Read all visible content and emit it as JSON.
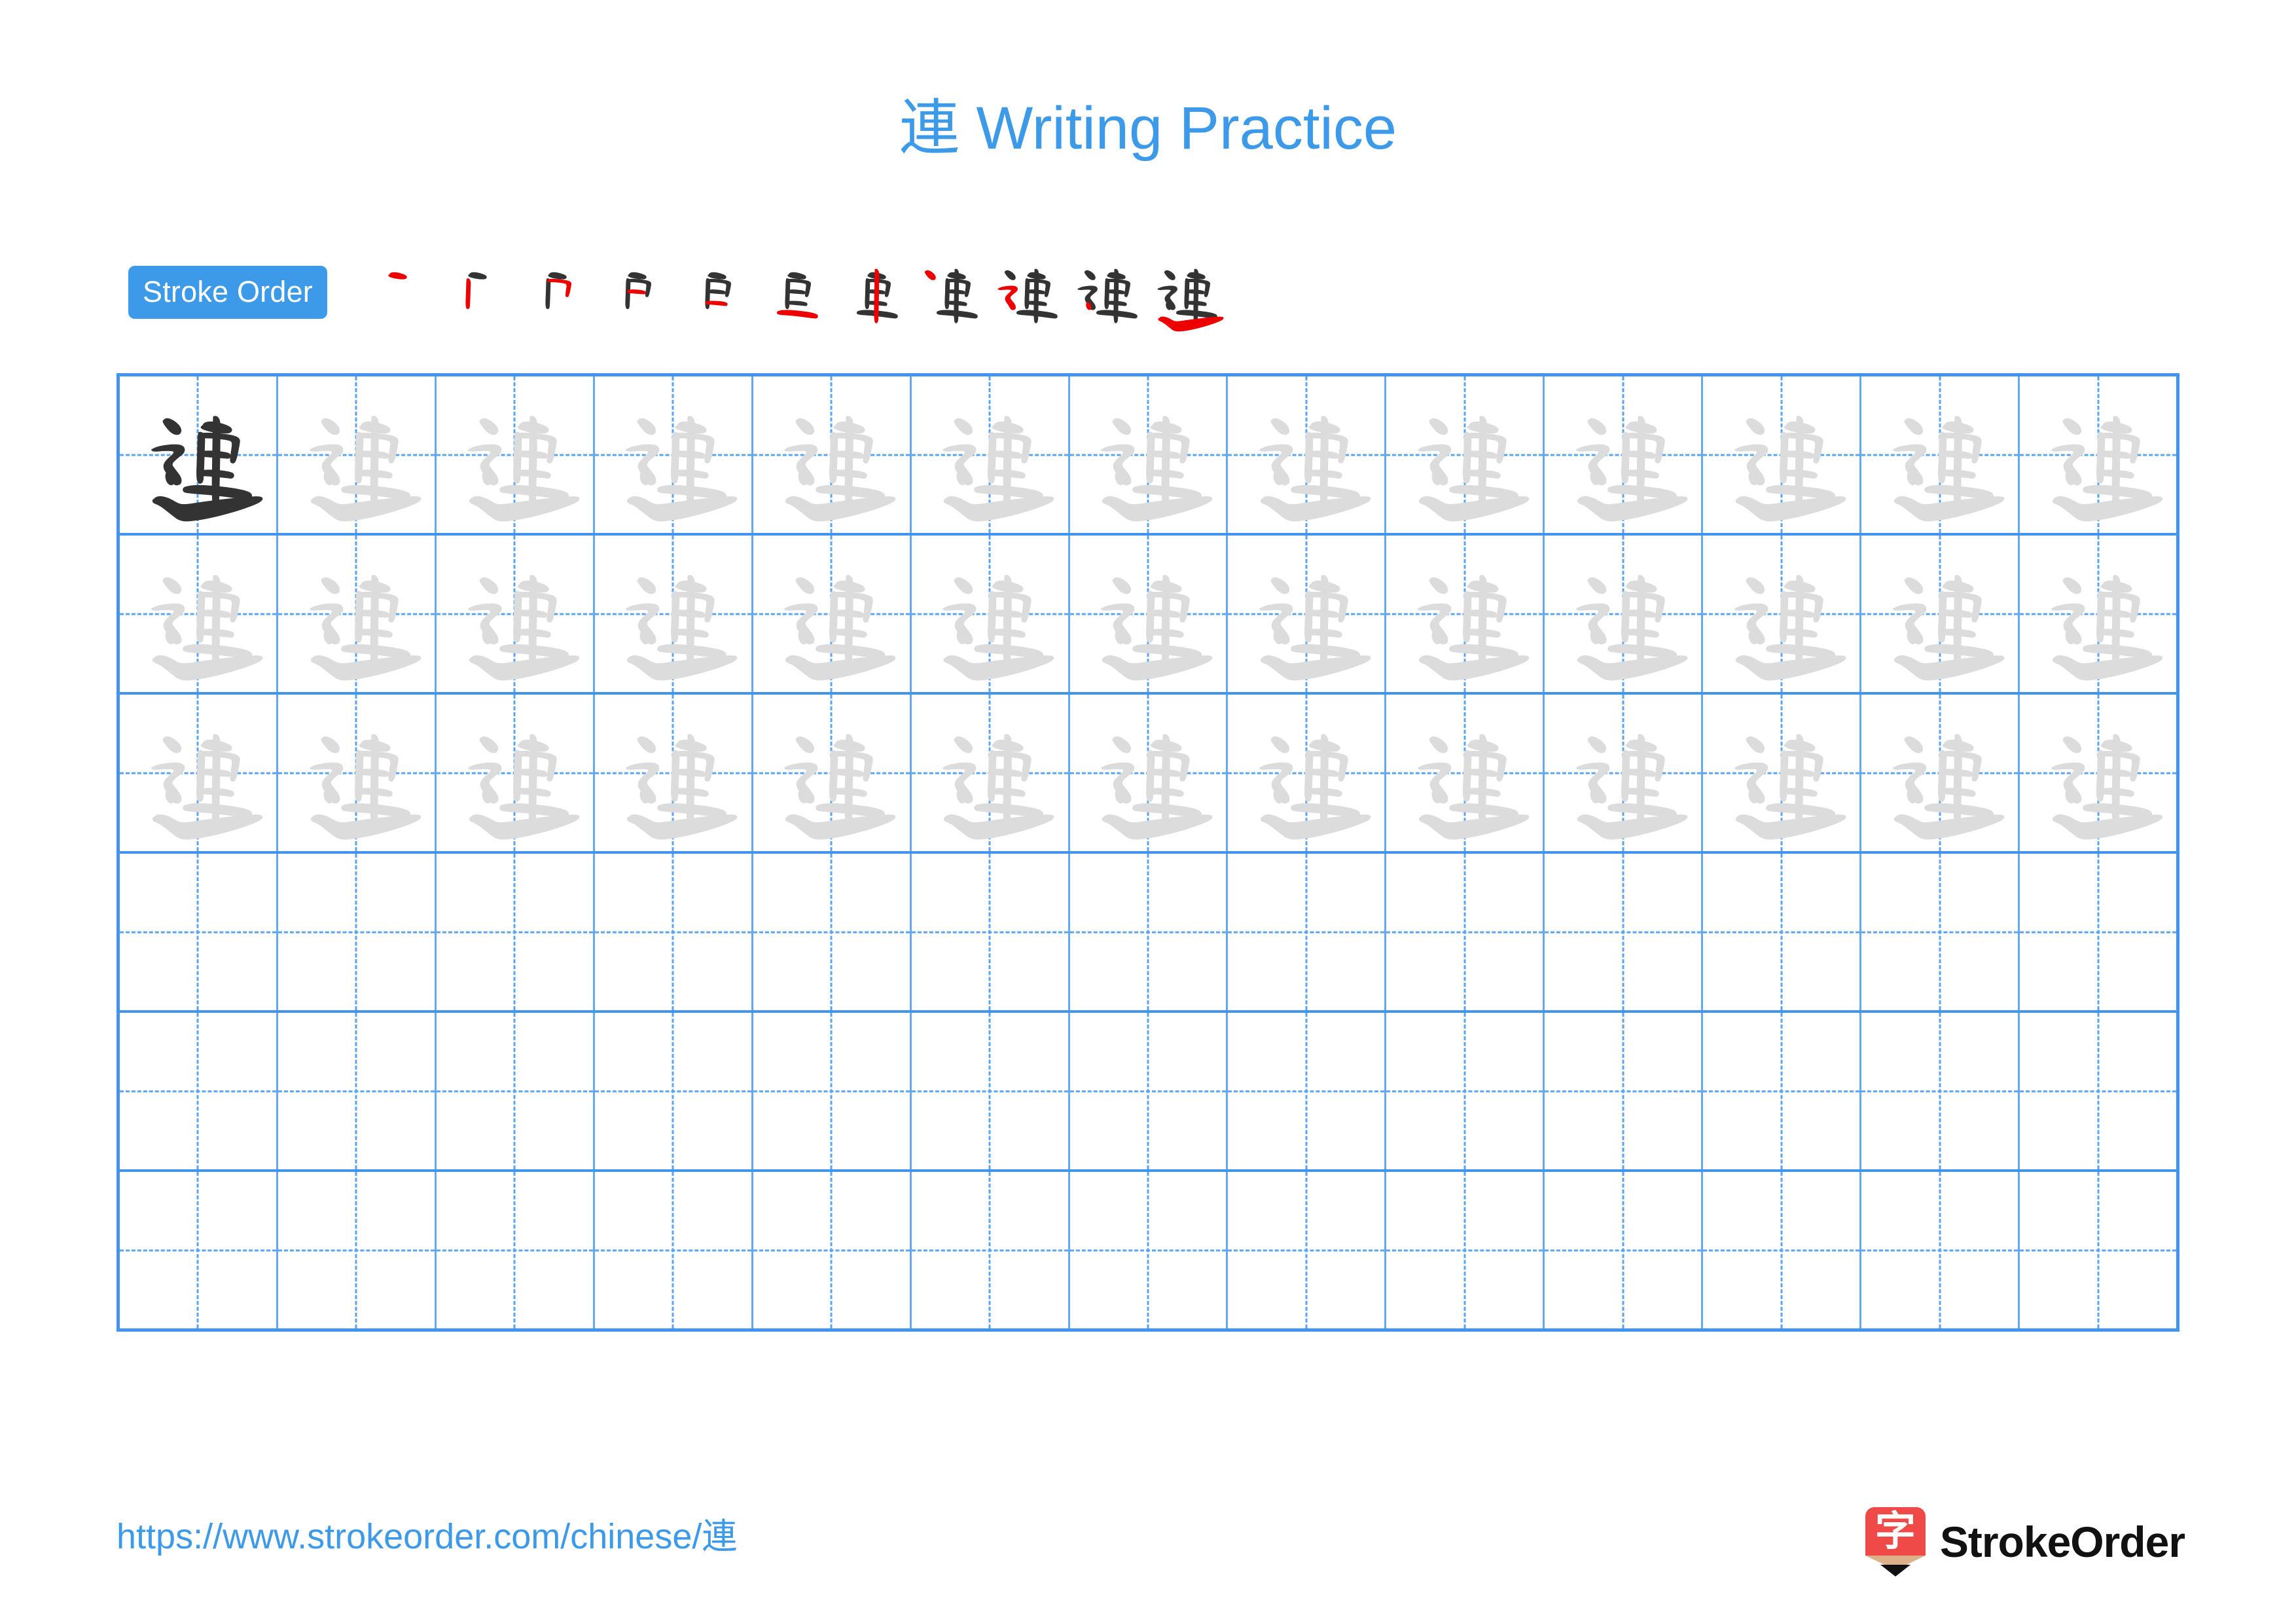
{
  "document": {
    "character": "連",
    "title": "連 Writing Practice",
    "title_character": "連",
    "title_text": " Writing Practice",
    "background_color": "#ffffff"
  },
  "colors": {
    "accent_blue": "#3d9ae8",
    "grid_border_blue": "#4294ee",
    "grid_inner_blue": "#64a9f0",
    "guide_dash_blue": "#5ba4ef",
    "stroke_new_red": "#ee0000",
    "stroke_done_black": "#333333",
    "trace_gray": "#dcdcdc",
    "logo_red": "#ef4a48",
    "logo_wood": "#dcb189"
  },
  "stroke_order": {
    "badge_label": "Stroke Order",
    "total_strokes": 11,
    "steps": [
      {
        "index": 1,
        "new_stroke": 1,
        "strokes_shown": 1
      },
      {
        "index": 2,
        "new_stroke": 2,
        "strokes_shown": 2
      },
      {
        "index": 3,
        "new_stroke": 3,
        "strokes_shown": 3
      },
      {
        "index": 4,
        "new_stroke": 4,
        "strokes_shown": 4
      },
      {
        "index": 5,
        "new_stroke": 5,
        "strokes_shown": 5
      },
      {
        "index": 6,
        "new_stroke": 6,
        "strokes_shown": 6
      },
      {
        "index": 7,
        "new_stroke": 7,
        "strokes_shown": 7
      },
      {
        "index": 8,
        "new_stroke": 8,
        "strokes_shown": 8
      },
      {
        "index": 9,
        "new_stroke": 9,
        "strokes_shown": 9
      },
      {
        "index": 10,
        "new_stroke": 10,
        "strokes_shown": 10
      },
      {
        "index": 11,
        "new_stroke": 11,
        "strokes_shown": 11
      }
    ]
  },
  "practice_grid": {
    "columns": 13,
    "rows": 6,
    "rows_detail": [
      {
        "row": 1,
        "cells": [
          "dark",
          "trace",
          "trace",
          "trace",
          "trace",
          "trace",
          "trace",
          "trace",
          "trace",
          "trace",
          "trace",
          "trace",
          "trace"
        ]
      },
      {
        "row": 2,
        "cells": [
          "trace",
          "trace",
          "trace",
          "trace",
          "trace",
          "trace",
          "trace",
          "trace",
          "trace",
          "trace",
          "trace",
          "trace",
          "trace"
        ]
      },
      {
        "row": 3,
        "cells": [
          "trace",
          "trace",
          "trace",
          "trace",
          "trace",
          "trace",
          "trace",
          "trace",
          "trace",
          "trace",
          "trace",
          "trace",
          "trace"
        ]
      },
      {
        "row": 4,
        "cells": [
          "empty",
          "empty",
          "empty",
          "empty",
          "empty",
          "empty",
          "empty",
          "empty",
          "empty",
          "empty",
          "empty",
          "empty",
          "empty"
        ]
      },
      {
        "row": 5,
        "cells": [
          "empty",
          "empty",
          "empty",
          "empty",
          "empty",
          "empty",
          "empty",
          "empty",
          "empty",
          "empty",
          "empty",
          "empty",
          "empty"
        ]
      },
      {
        "row": 6,
        "cells": [
          "empty",
          "empty",
          "empty",
          "empty",
          "empty",
          "empty",
          "empty",
          "empty",
          "empty",
          "empty",
          "empty",
          "empty",
          "empty"
        ]
      }
    ]
  },
  "footer": {
    "url": "https://www.strokeorder.com/chinese/連",
    "url_text": "https://www.strokeorder.com/chinese/",
    "url_character": "連",
    "brand_name": "StrokeOrder",
    "brand_mark_character": "字"
  }
}
